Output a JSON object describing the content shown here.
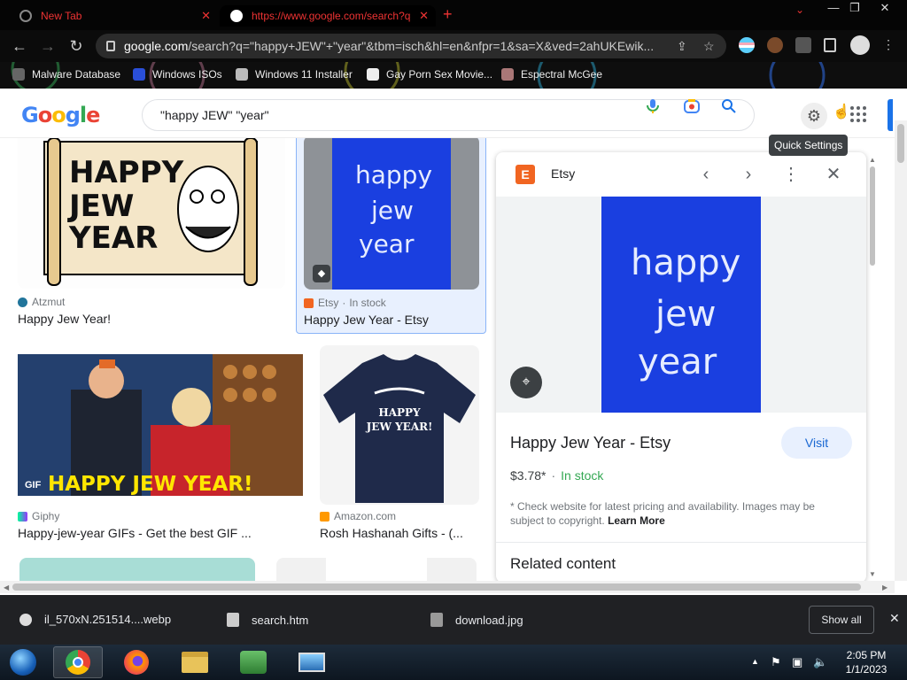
{
  "browser": {
    "tabs": [
      {
        "label": "New Tab",
        "active": false
      },
      {
        "label": "https://www.google.com/search?q=",
        "active": true
      }
    ],
    "url_host": "google.com",
    "url_rest": "/search?q=\"happy+JEW\"+\"year\"&tbm=isch&hl=en&nfpr=1&sa=X&ved=2ahUKEwik...",
    "bookmarks": [
      "Malware Database",
      "Windows ISOs",
      "Windows 11 Installer",
      "Gay Porn Sex Movie...",
      "Espectral McGee"
    ]
  },
  "google": {
    "logo": "Google",
    "query": "\"happy JEW\" \"year\"",
    "tooltip": "Quick Settings"
  },
  "results": [
    {
      "source": "Atzmut",
      "title": "Happy Jew Year!",
      "image_text": [
        "HAPPY",
        "JEW",
        "YEAR"
      ]
    },
    {
      "source": "Etsy",
      "stock": "In stock",
      "title": "Happy Jew Year - Etsy",
      "image_text": [
        "happy",
        "jew",
        "year"
      ]
    },
    {
      "source": "Giphy",
      "title": "Happy-jew-year GIFs - Get the best GIF ...",
      "badge": "GIF",
      "image_text": "HAPPY JEW YEAR!"
    },
    {
      "source": "Amazon.com",
      "title": "Rosh Hashanah Gifts - (...",
      "image_text": [
        "HAPPY",
        "JEW YEAR!"
      ]
    }
  ],
  "panel": {
    "site": "Etsy",
    "site_badge": "E",
    "image_text": [
      "happy",
      "jew",
      "year"
    ],
    "title": "Happy Jew Year - Etsy",
    "visit_label": "Visit",
    "price": "$3.78*",
    "stock": "In stock",
    "disclaimer": "* Check website for latest pricing and availability. Images may be subject to copyright.",
    "learn_more": "Learn More",
    "related": "Related content"
  },
  "downloads": {
    "items": [
      "il_570xN.251514....webp",
      "search.htm",
      "download.jpg"
    ],
    "show_all": "Show all"
  },
  "taskbar": {
    "time": "2:05 PM",
    "date": "1/1/2023"
  },
  "colors": {
    "google_blue": "#1a73e8",
    "etsy_orange": "#f16521",
    "in_stock_green": "#34a853",
    "tab_red": "#ee3333",
    "etsy_image_blue": "#1a3fe0"
  }
}
